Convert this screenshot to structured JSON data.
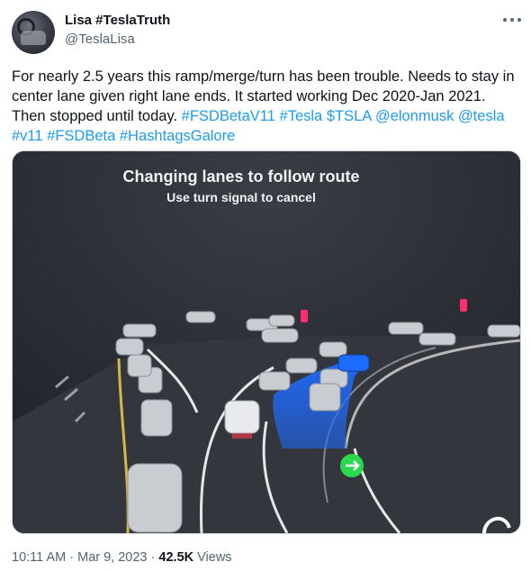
{
  "author": {
    "name": "Lisa #TeslaTruth",
    "handle": "@TeslaLisa"
  },
  "tweet": {
    "text_plain": "For nearly 2.5 years this ramp/merge/turn has been trouble. Needs to stay in center lane given right lane ends. It started working Dec 2020-Jan 2021. Then stopped until today.",
    "tags": [
      "#FSDBetaV11",
      "#Tesla",
      "$TSLA",
      "@elonmusk",
      "@tesla",
      "#v11",
      "#FSDBeta",
      "#HashtagsGalore"
    ]
  },
  "media": {
    "headline": "Changing lanes to follow route",
    "subline": "Use turn signal to cancel",
    "colors": {
      "route": "#1e6bff",
      "background": "#2a2c33",
      "signal": "#2bd94f"
    }
  },
  "meta": {
    "time": "10:11 AM",
    "separator": "·",
    "date": "Mar 9, 2023",
    "views": "42.5K",
    "views_label": "Views"
  }
}
